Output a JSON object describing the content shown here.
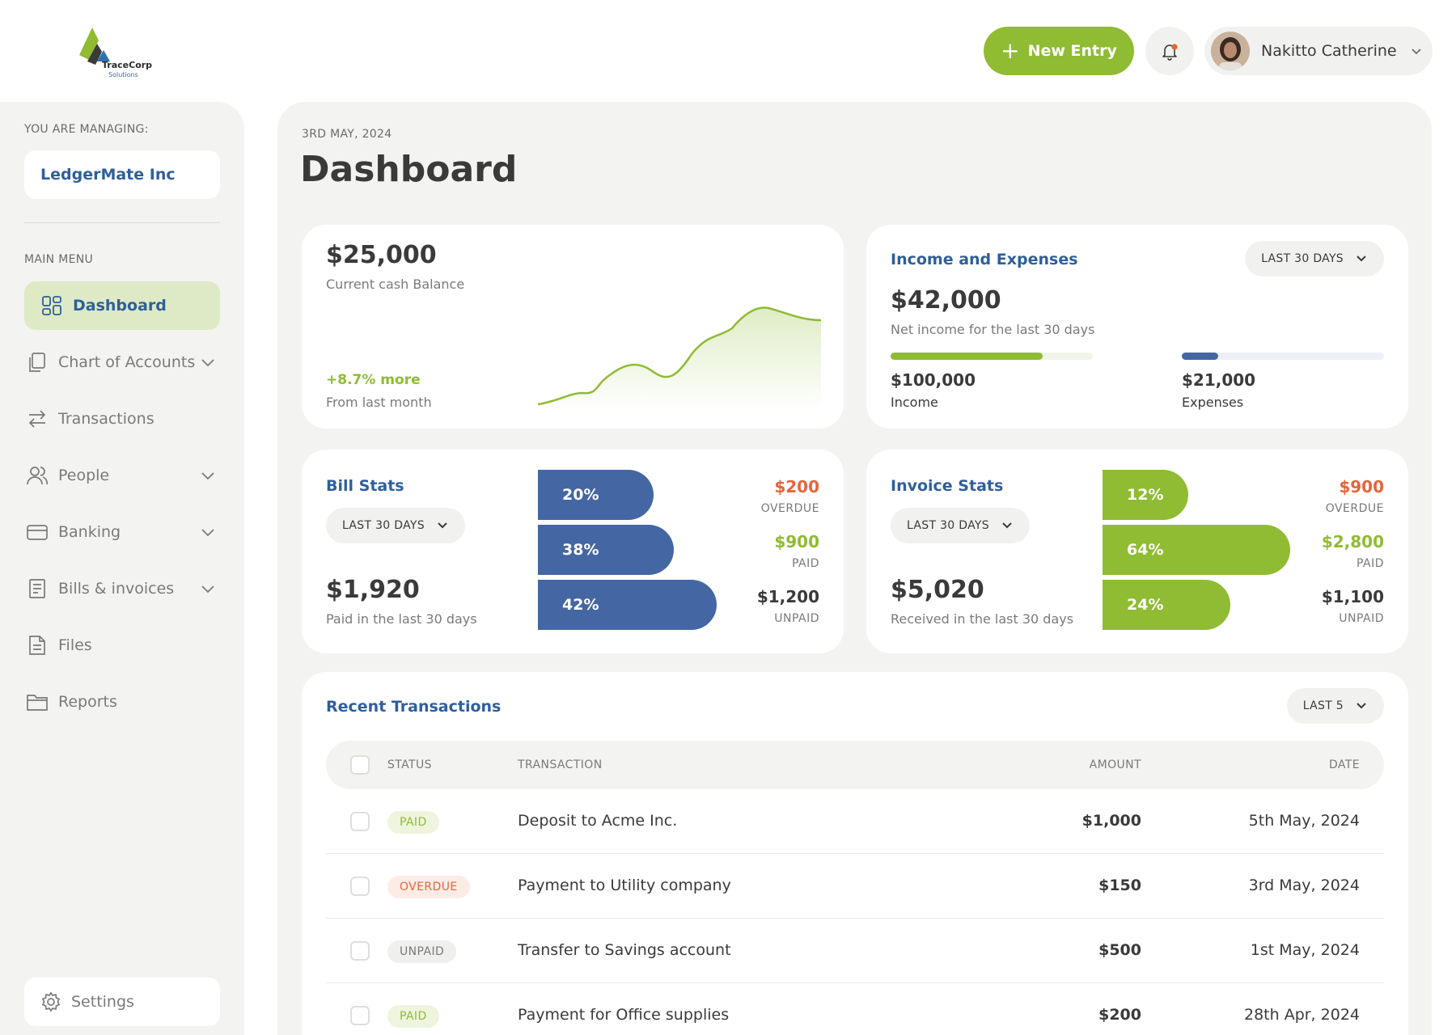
{
  "brand": {
    "name": "TraceCorp",
    "tagline": "Solutions"
  },
  "header": {
    "new_entry_label": "New Entry",
    "user_name": "Nakitto Catherine",
    "notification_dot_color": "#e8643a"
  },
  "sidebar": {
    "managing_label": "YOU ARE MANAGING:",
    "company": "LedgerMate Inc",
    "menu_label": "MAIN MENU",
    "items": [
      {
        "label": "Dashboard",
        "icon": "grid-icon",
        "active": true
      },
      {
        "label": "Chart of Accounts",
        "icon": "copy-icon",
        "expandable": true
      },
      {
        "label": "Transactions",
        "icon": "arrows-swap-icon"
      },
      {
        "label": "People",
        "icon": "users-icon",
        "expandable": true
      },
      {
        "label": "Banking",
        "icon": "credit-card-icon",
        "expandable": true
      },
      {
        "label": "Bills & invoices",
        "icon": "receipt-icon",
        "expandable": true
      },
      {
        "label": "Files",
        "icon": "file-icon"
      },
      {
        "label": "Reports",
        "icon": "folder-icon"
      }
    ],
    "settings_label": "Settings"
  },
  "page": {
    "date": "3RD MAY, 2024",
    "title": "Dashboard"
  },
  "cash": {
    "amount": "$25,000",
    "label": "Current cash Balance",
    "change": "+8.7% more",
    "change_label": "From last month"
  },
  "income_expenses": {
    "title": "Income and Expenses",
    "period": "LAST 30 DAYS",
    "net": "$42,000",
    "net_label": "Net income for the last 30 days",
    "income_value": "$100,000",
    "income_label": "Income",
    "income_fill": 0.75,
    "expenses_value": "$21,000",
    "expenses_label": "Expenses",
    "expenses_fill": 0.18
  },
  "bill_stats": {
    "title": "Bill Stats",
    "period": "LAST 30 DAYS",
    "total": "$1,920",
    "total_label": "Paid in the last 30 days",
    "bars": [
      {
        "pct": "20%",
        "amount": "$200",
        "label": "OVERDUE"
      },
      {
        "pct": "38%",
        "amount": "$900",
        "label": "PAID"
      },
      {
        "pct": "42%",
        "amount": "$1,200",
        "label": "UNPAID"
      }
    ]
  },
  "invoice_stats": {
    "title": "Invoice Stats",
    "period": "LAST 30 DAYS",
    "total": "$5,020",
    "total_label": "Received in the last 30 days",
    "bars": [
      {
        "pct": "12%",
        "amount": "$900",
        "label": "OVERDUE"
      },
      {
        "pct": "64%",
        "amount": "$2,800",
        "label": "PAID"
      },
      {
        "pct": "24%",
        "amount": "$1,100",
        "label": "UNPAID"
      }
    ]
  },
  "colors": {
    "brand_green": "#8fbc32",
    "brand_blue": "#4467a3",
    "overdue": "#e8643a",
    "title_blue": "#2f5f9c"
  },
  "transactions": {
    "title": "Recent Transactions",
    "filter": "LAST 5",
    "columns": [
      "STATUS",
      "TRANSACTION",
      "AMOUNT",
      "DATE"
    ],
    "rows": [
      {
        "status": "PAID",
        "description": "Deposit to Acme Inc.",
        "amount": "$1,000",
        "date": "5th May, 2024"
      },
      {
        "status": "OVERDUE",
        "description": "Payment to Utility company",
        "amount": "$150",
        "date": "3rd May, 2024"
      },
      {
        "status": "UNPAID",
        "description": "Transfer to Savings account",
        "amount": "$500",
        "date": "1st May, 2024"
      },
      {
        "status": "PAID",
        "description": "Payment for Office supplies",
        "amount": "$200",
        "date": "28th Apr, 2024"
      }
    ]
  }
}
